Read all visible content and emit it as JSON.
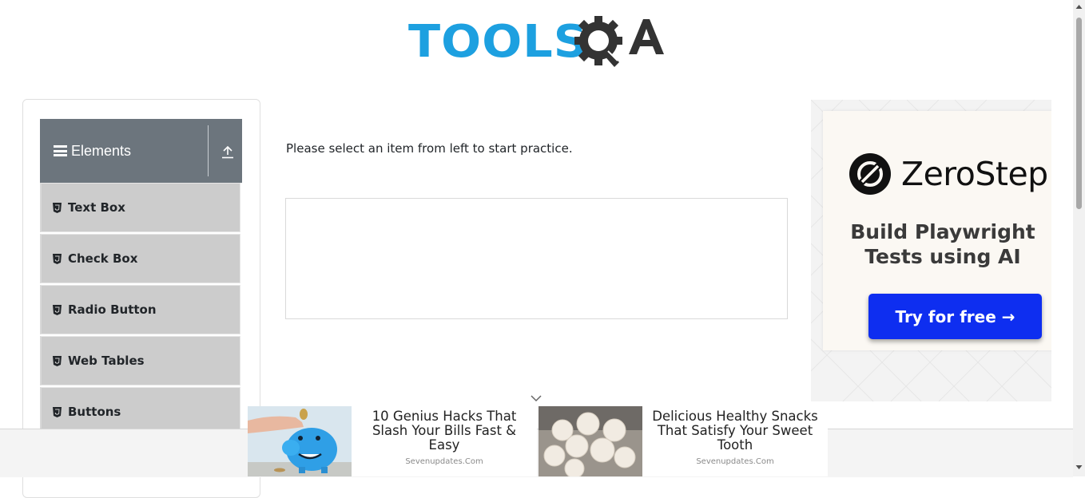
{
  "logo": {
    "text": "TOOLS",
    "qa_text": "QA"
  },
  "sidebar": {
    "group_title": "Elements",
    "items": [
      {
        "label": "Text Box"
      },
      {
        "label": "Check Box"
      },
      {
        "label": "Radio Button"
      },
      {
        "label": "Web Tables"
      },
      {
        "label": "Buttons"
      }
    ]
  },
  "main": {
    "instruction": "Please select an item from left to start practice."
  },
  "side_ad": {
    "brand": "ZeroStep",
    "headline_line1": "Build Playwright",
    "headline_line2": "Tests using AI",
    "cta": "Try for free →",
    "cta_color": "#0e2ef0"
  },
  "bottom_ads": [
    {
      "headline": "10 Genius Hacks That Slash Your Bills Fast & Easy",
      "source": "Sevenupdates.Com"
    },
    {
      "headline": "Delicious Healthy Snacks That Satisfy Your Sweet Tooth",
      "source": "Sevenupdates.Com"
    }
  ],
  "colors": {
    "accent": "#1da0e0",
    "sidebar_header": "#6c757d",
    "menu_item_bg": "#cccccc"
  }
}
